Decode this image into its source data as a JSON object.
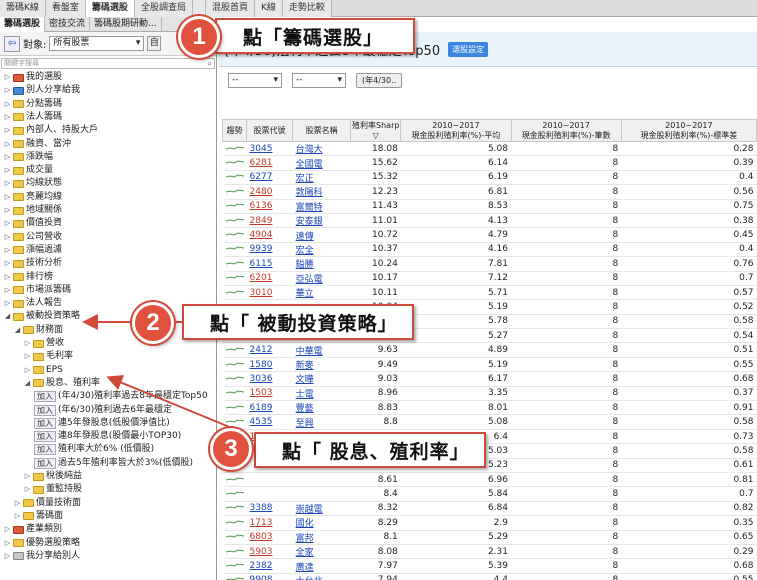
{
  "top_tabs": [
    "籌碼K線",
    "看盤室",
    "籌碼選股",
    "全股調查局",
    "",
    "混股首頁",
    "K線",
    "走勢比較"
  ],
  "sub_tabs": [
    "籌碼選股",
    "密技交流",
    "籌碼股期研動..."
  ],
  "left": {
    "object_label": "對象:",
    "object_value": "所有股票",
    "object_btn": "自",
    "search_placeholder": "關鍵字搜尋",
    "tree": [
      {
        "label": "我的選股",
        "color": "red",
        "depth": 0
      },
      {
        "label": "別人分享給我",
        "color": "blue",
        "depth": 0
      },
      {
        "label": "分點籌碼",
        "color": "yellow",
        "depth": 0
      },
      {
        "label": "法人籌碼",
        "color": "yellow",
        "depth": 0
      },
      {
        "label": "內部人、持股大戶",
        "color": "yellow",
        "depth": 0
      },
      {
        "label": "融資、當沖",
        "color": "yellow",
        "depth": 0
      },
      {
        "label": "漲跌幅",
        "color": "yellow",
        "depth": 0
      },
      {
        "label": "成交量",
        "color": "yellow",
        "depth": 0
      },
      {
        "label": "均線狀態",
        "color": "yellow",
        "depth": 0
      },
      {
        "label": "亮麗均線",
        "color": "yellow",
        "depth": 0
      },
      {
        "label": "地域關係",
        "color": "yellow",
        "depth": 0
      },
      {
        "label": "價值投資",
        "color": "yellow",
        "depth": 0
      },
      {
        "label": "公司營收",
        "color": "yellow",
        "depth": 0
      },
      {
        "label": "漲幅過濾",
        "color": "yellow",
        "depth": 0
      },
      {
        "label": "技術分析",
        "color": "yellow",
        "depth": 0
      },
      {
        "label": "排行榜",
        "color": "yellow",
        "depth": 0
      },
      {
        "label": "市場派籌碼",
        "color": "yellow",
        "depth": 0
      },
      {
        "label": "法人報告",
        "color": "yellow",
        "depth": 0
      },
      {
        "label": "被動投資策略",
        "color": "yellow",
        "depth": 0
      },
      {
        "label": "財務面",
        "color": "yellow",
        "depth": 1
      },
      {
        "label": "營收",
        "color": "yellow",
        "depth": 2
      },
      {
        "label": "毛利率",
        "color": "yellow",
        "depth": 2
      },
      {
        "label": "EPS",
        "color": "yellow",
        "depth": 2
      },
      {
        "label": "股息、殖利率",
        "color": "yellow",
        "depth": 2
      },
      {
        "label": "(年4/30)殖利率過去8年最穩定Top50",
        "add": true,
        "depth": 3
      },
      {
        "label": "(年6/30)殖利過去6年最穩定",
        "add": true,
        "depth": 3
      },
      {
        "label": "連5年發股息(低股價淨值比)",
        "add": true,
        "depth": 3
      },
      {
        "label": "連8年發股息(股價最小TOP30)",
        "add": true,
        "depth": 3
      },
      {
        "label": "殖利率大於6% (低價股)",
        "add": true,
        "depth": 3
      },
      {
        "label": "過去5年殖利率皆大於3%(低價股)",
        "add": true,
        "depth": 3
      },
      {
        "label": "稅後純益",
        "color": "yellow",
        "depth": 2
      },
      {
        "label": "董監持股",
        "color": "yellow",
        "depth": 2
      },
      {
        "label": "價量技術面",
        "color": "yellow",
        "depth": 1
      },
      {
        "label": "籌碼面",
        "color": "yellow",
        "depth": 1
      },
      {
        "label": "產業類別",
        "color": "red",
        "depth": 0
      },
      {
        "label": "優勢選股策略",
        "color": "yellow",
        "depth": 0
      },
      {
        "label": "我分享給別人",
        "color": "gray",
        "depth": 0
      }
    ],
    "add_label": "加入"
  },
  "right": {
    "title": "(年4/30)殖利率過去8年最穩定Top50",
    "setting_btn": "選股設定",
    "filter1": "--",
    "filter2": "--",
    "filter_btn": "(年4/30..",
    "columns": [
      "趨勢",
      "股票代號",
      "股票名稱",
      "殖利率Sharp ▽",
      "2010~2017\n現金股利殖利率(%)-平均",
      "2010~2017\n現金股利殖利率(%)-筆數",
      "2010~2017\n現金股利殖利率(%)-標準差"
    ],
    "rows": [
      [
        "3045",
        "台灣大",
        "18.08",
        "5.08",
        "8",
        "0.28"
      ],
      [
        "6281",
        "全國電",
        "15.62",
        "6.14",
        "8",
        "0.39"
      ],
      [
        "6277",
        "宏正",
        "15.32",
        "6.19",
        "8",
        "0.4"
      ],
      [
        "2480",
        "敦陽科",
        "12.23",
        "6.81",
        "8",
        "0.56"
      ],
      [
        "6136",
        "富爾特",
        "11.43",
        "8.53",
        "8",
        "0.75"
      ],
      [
        "2849",
        "安泰銀",
        "11.01",
        "4.13",
        "8",
        "0.38"
      ],
      [
        "4904",
        "遠傳",
        "10.72",
        "4.79",
        "8",
        "0.45"
      ],
      [
        "9939",
        "宏全",
        "10.37",
        "4.16",
        "8",
        "0.4"
      ],
      [
        "6115",
        "鎰勝",
        "10.24",
        "7.81",
        "8",
        "0.76"
      ],
      [
        "6201",
        "亞弘電",
        "10.17",
        "7.12",
        "8",
        "0.7"
      ],
      [
        "3010",
        "華立",
        "10.11",
        "5.71",
        "8",
        "0.57"
      ],
      [
        "",
        "",
        "10.04",
        "5.19",
        "8",
        "0.52"
      ],
      [
        "",
        "",
        "9.92",
        "5.78",
        "8",
        "0.58"
      ],
      [
        "",
        "",
        "9.76",
        "5.27",
        "8",
        "0.54"
      ],
      [
        "2412",
        "中華電",
        "9.63",
        "4.89",
        "8",
        "0.51"
      ],
      [
        "1580",
        "新麥",
        "9.49",
        "5.19",
        "8",
        "0.55"
      ],
      [
        "3036",
        "文曄",
        "9.03",
        "6.17",
        "8",
        "0.68"
      ],
      [
        "1503",
        "士電",
        "8.96",
        "3.35",
        "8",
        "0.37"
      ],
      [
        "6189",
        "豐藝",
        "8.83",
        "8.01",
        "8",
        "0.91"
      ],
      [
        "4535",
        "至興",
        "8.8",
        "5.08",
        "8",
        "0.58"
      ],
      [
        "1726",
        "永記",
        "8.78",
        "6.4",
        "8",
        "0.73"
      ],
      [
        "",
        "",
        "8.69",
        "5.03",
        "8",
        "0.58"
      ],
      [
        "",
        "",
        "8.64",
        "5.23",
        "8",
        "0.61"
      ],
      [
        "",
        "",
        "8.61",
        "6.96",
        "8",
        "0.81"
      ],
      [
        "",
        "",
        "8.4",
        "5.84",
        "8",
        "0.7"
      ],
      [
        "3388",
        "崇越電",
        "8.32",
        "6.84",
        "8",
        "0.82"
      ],
      [
        "1713",
        "國化",
        "8.29",
        "2.9",
        "8",
        "0.35"
      ],
      [
        "6803",
        "富邦",
        "8.1",
        "5.29",
        "8",
        "0.65"
      ],
      [
        "5903",
        "全家",
        "8.08",
        "2.31",
        "8",
        "0.29"
      ],
      [
        "2382",
        "廣達",
        "7.97",
        "5.39",
        "8",
        "0.68"
      ],
      [
        "9908",
        "大台北",
        "7.94",
        "4.4",
        "8",
        "0.55"
      ],
      [
        "2015",
        "豐興",
        "7.91",
        "5.8",
        "8",
        "0.73"
      ]
    ]
  },
  "callouts": [
    {
      "num": "1",
      "text": "點「籌碼選股」"
    },
    {
      "num": "2",
      "text": "點「 被動投資策略」"
    },
    {
      "num": "3",
      "text": "點「 股息、殖利率」"
    }
  ],
  "colors": {
    "accent": "#d04a3a",
    "badge": "#e0523e",
    "link": "#1a46b8"
  }
}
